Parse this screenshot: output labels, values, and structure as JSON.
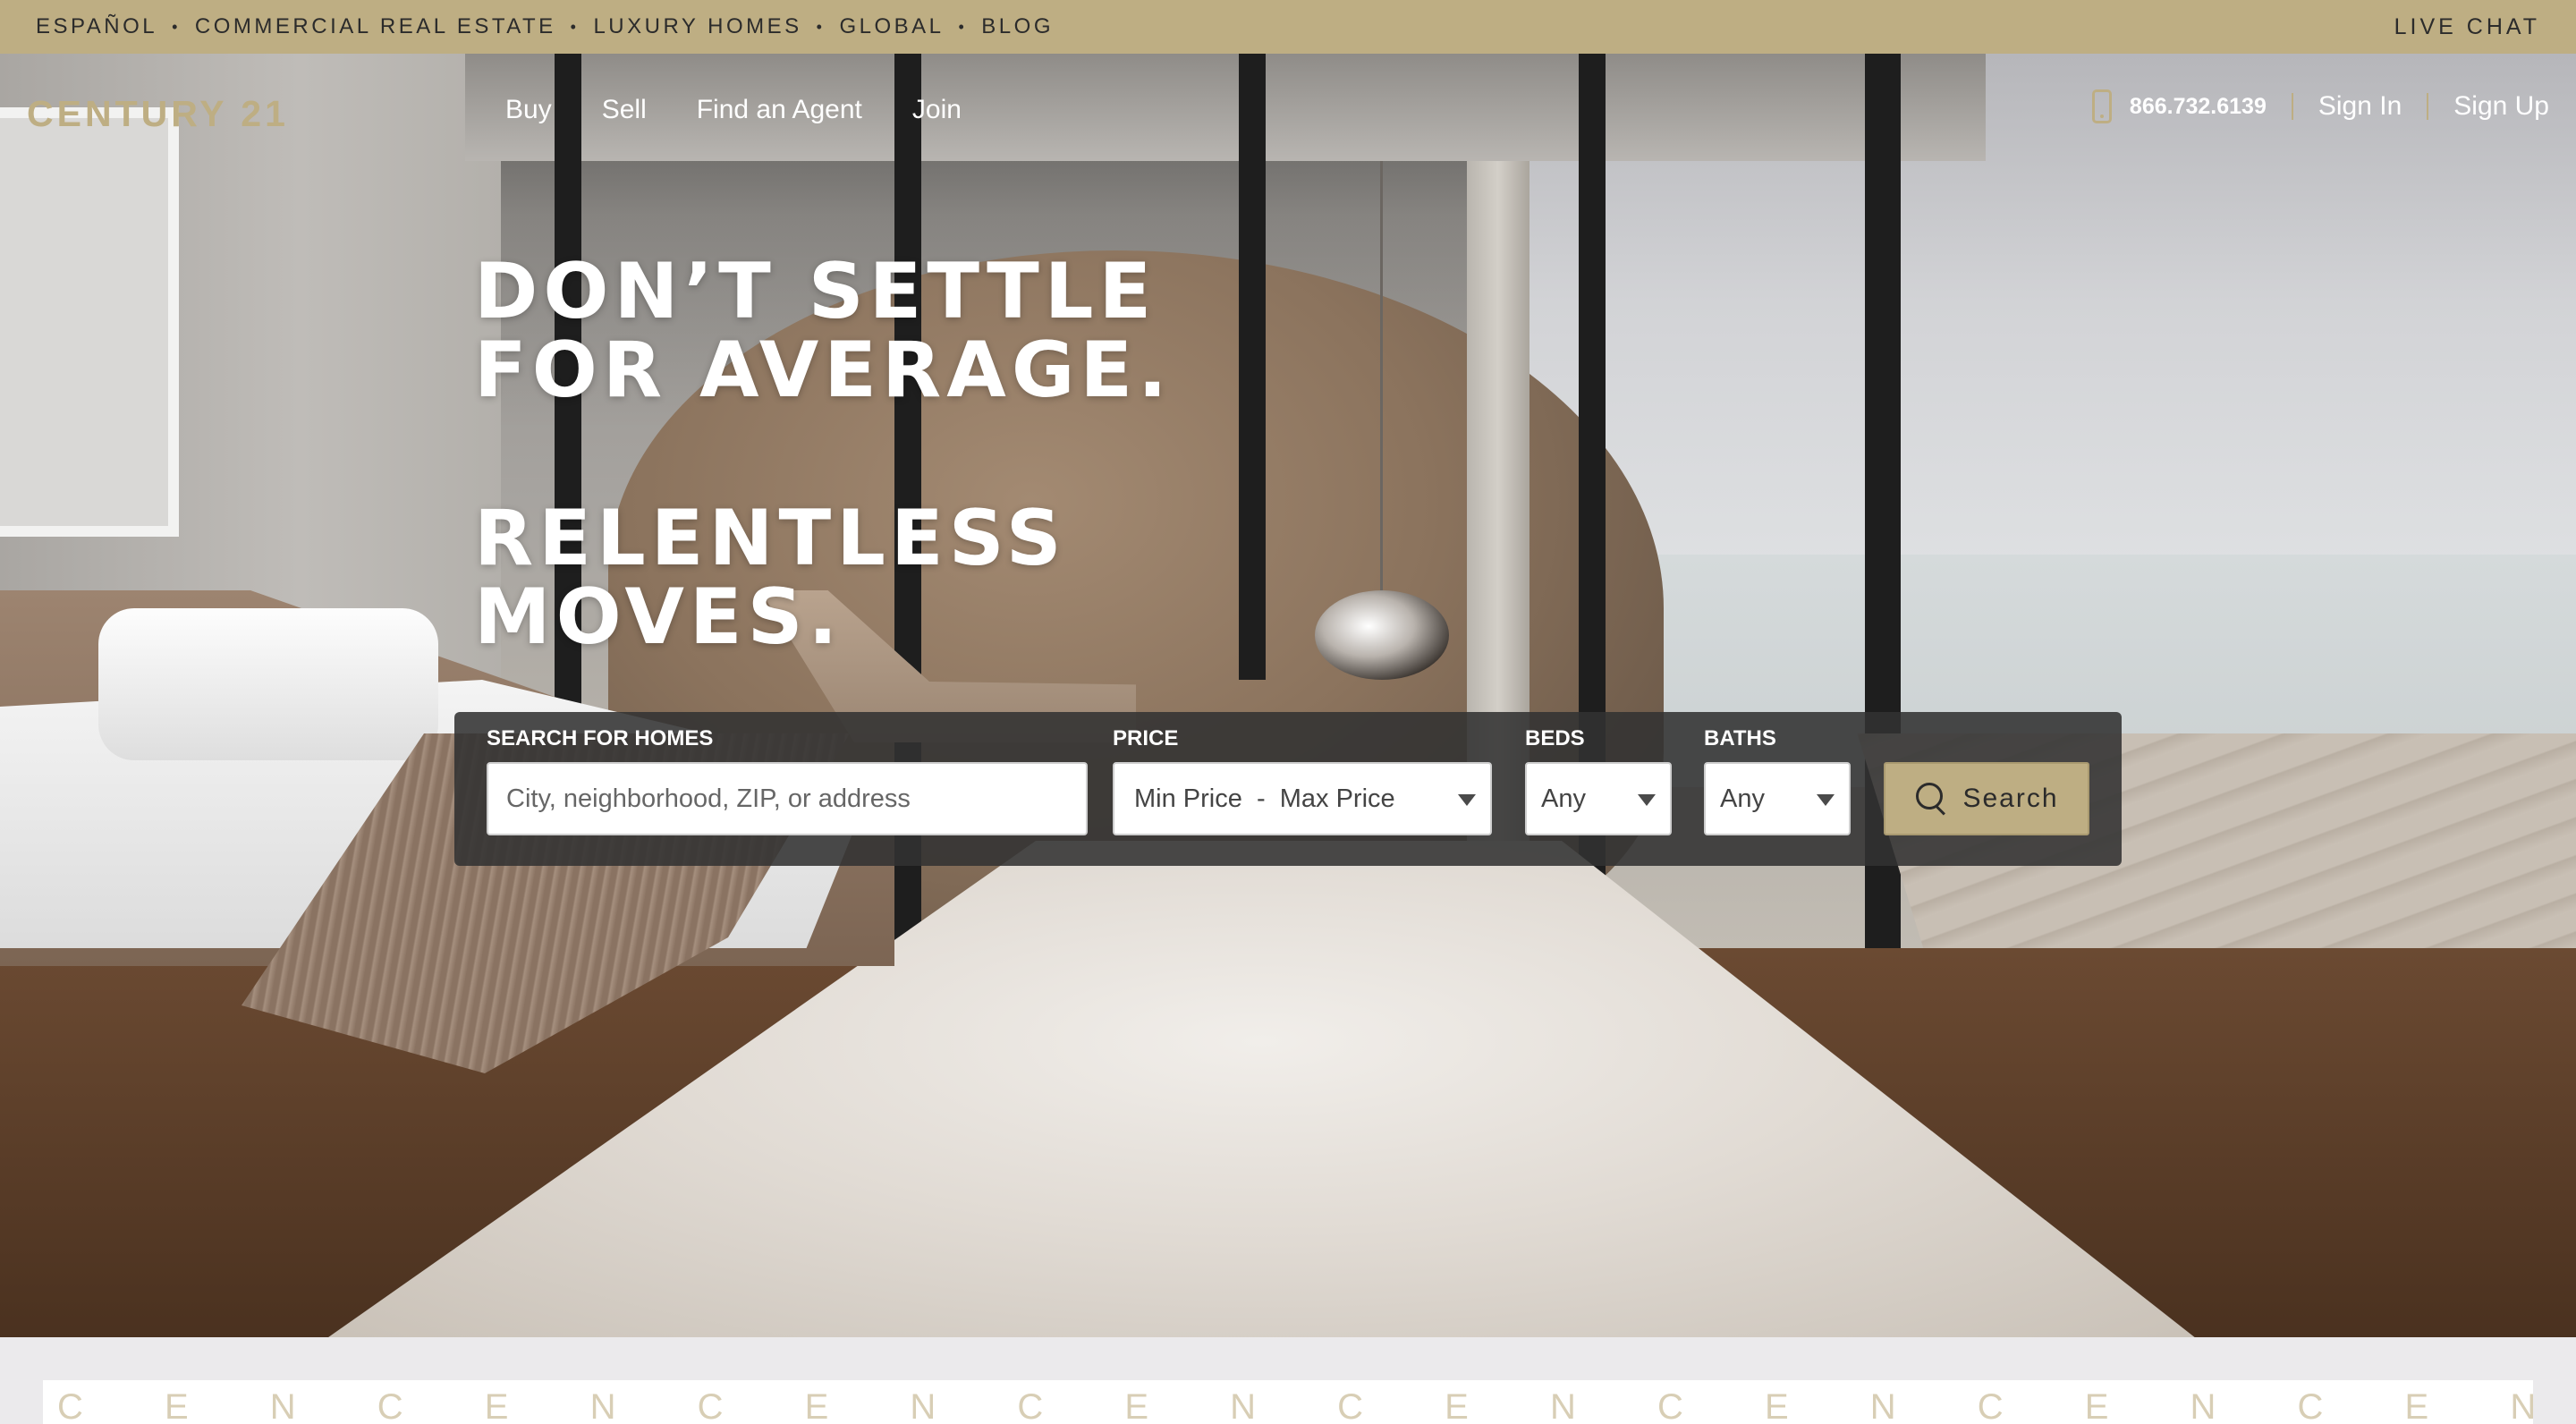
{
  "utility_bar": {
    "links": [
      "ESPAÑOL",
      "COMMERCIAL REAL ESTATE",
      "LUXURY HOMES",
      "GLOBAL",
      "BLOG"
    ],
    "separator": "•",
    "live_chat": "LIVE CHAT"
  },
  "header": {
    "logo": "CENTURY 21",
    "nav": [
      "Buy",
      "Sell",
      "Find an Agent",
      "Join"
    ],
    "phone": "866.732.6139",
    "sign_in": "Sign In",
    "sign_up": "Sign Up"
  },
  "hero": {
    "headline_line1": "DON’T SETTLE",
    "headline_line2": "FOR AVERAGE.",
    "headline_line3": "RELENTLESS",
    "headline_line4": "MOVES."
  },
  "search": {
    "location_label": "SEARCH FOR HOMES",
    "location_placeholder": "City, neighborhood, ZIP, or address",
    "price_label": "PRICE",
    "price_value": "Min Price  -  Max Price",
    "beds_label": "BEDS",
    "beds_value": "Any",
    "baths_label": "BATHS",
    "baths_value": "Any",
    "button_label": "Search",
    "button_icon": "search-icon"
  },
  "pattern": {
    "text": "C E N C E N C E N C E N C E N C E N C E N C E N C E N C E N C E N C E N C E N C E N C E N C E N C E N C E N C E N C E N C E N C"
  },
  "colors": {
    "brand_gold": "#beae83",
    "panel_dark": "#323232"
  }
}
